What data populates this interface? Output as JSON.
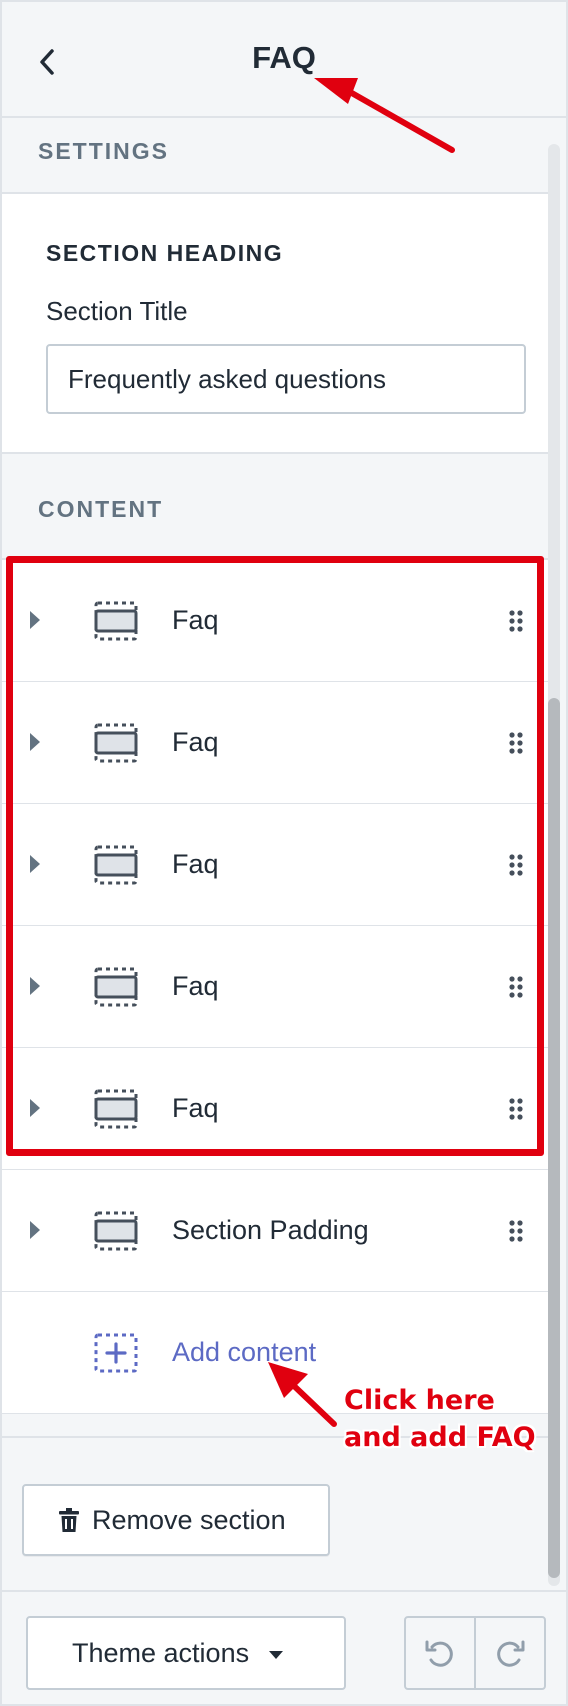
{
  "header": {
    "title": "FAQ"
  },
  "settings": {
    "section_label": "SETTINGS",
    "heading_label": "SECTION HEADING",
    "field_label": "Section Title",
    "field_value": "Frequently asked questions"
  },
  "content": {
    "section_label": "CONTENT",
    "items": [
      {
        "label": "Faq"
      },
      {
        "label": "Faq"
      },
      {
        "label": "Faq"
      },
      {
        "label": "Faq"
      },
      {
        "label": "Faq"
      },
      {
        "label": "Section Padding"
      }
    ],
    "add_label": "Add content"
  },
  "actions": {
    "remove_label": "Remove section"
  },
  "footer": {
    "theme_actions_label": "Theme actions"
  },
  "annotation": {
    "line1": "Click here",
    "line2": "and add FAQ"
  },
  "colors": {
    "annotation_red": "#e0000f",
    "link_blue": "#5c6ac4",
    "icon_gray": "#637381"
  }
}
